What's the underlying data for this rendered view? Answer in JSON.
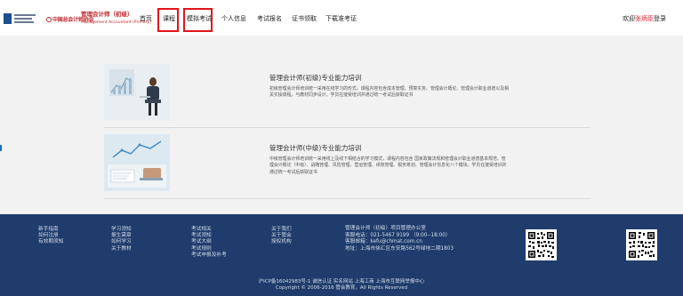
{
  "header": {
    "logo_association": "中国总会计师协会",
    "logo_program_cn": "管理会计师（初级）",
    "logo_program_en": "Management Accountant (Primary)",
    "nav": [
      "首页",
      "课程",
      "模拟考试",
      "个人信息",
      "考试报名",
      "证书领取",
      "下载准考证"
    ],
    "highlighted_nav": [
      "课程",
      "模拟考试"
    ],
    "welcome_prefix": "欢迎",
    "username": "张炳臣",
    "logout": "登录"
  },
  "courses": [
    {
      "title": "管理会计师(初级)专业能力培训",
      "description": "初级管理会计师培训统一采用在线学习的形式，课程内容包含成本管理、预算实务、管理会计概论、管理会计职业道德以及相关实操课程，与教材同步设计，学员在接受培训并通过统一考试后获取证书"
    },
    {
      "title": "管理会计师(中级)专业能力培训",
      "description": "中级管理会计师培训统一采用线上及线下相结合的学习模式，课程内容包含 国家政策法规和管理会计职业道德基本规范、管理会计概论（中级）、战略管理、风险管理、营运管理、绩效管理、税务筹划、管理会计信息化八个模块。学员在接受培训并通过统一考试后获取证书"
    }
  ],
  "footer": {
    "columns": [
      [
        "新手指南",
        "如何注册",
        "有效期须知"
      ],
      [
        "学习须知",
        "报生需章",
        "如何学习",
        "关于教材"
      ],
      [
        "考试相关",
        "考试须知",
        "考试大纲",
        "考试规则",
        "考试申报及补考"
      ],
      [
        "关于我们",
        "关于管会",
        "授权机构"
      ]
    ],
    "office": {
      "title": "管理会计师（初级）项目管理办公室",
      "phone": "客服电话：021-5467 9199 （9:00--18:00）",
      "email": "客服邮箱：kefu@chmat.com.cn",
      "address": "地址：上海市徐汇区东安路562号绿地二期1803"
    },
    "icp": "沪ICP备16042983号-1   诚信认证   实名网站   上海工商   上海市互联网举报中心",
    "copyright": "Copyright © 2006-2016 管会教育，All Rights Reserved"
  },
  "colors": {
    "accent_red": "#e3141b",
    "footer_bg": "#1f3c6c",
    "page_bg": "#f2f2f2"
  }
}
